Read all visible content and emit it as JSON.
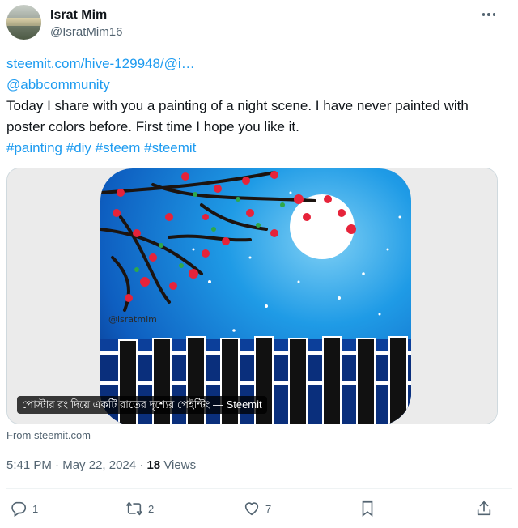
{
  "author": {
    "name": "Israt Mim",
    "handle": "@IsratMim16"
  },
  "post": {
    "link": "steemit.com/hive-129948/@i…",
    "mention": "@abbcommunity",
    "body": "Today I share with you a painting of a night scene. I have never painted with poster colors before. First time I hope you like it.",
    "hashtags": [
      "#painting",
      "#diy",
      "#steem",
      "#steemit"
    ]
  },
  "card": {
    "caption": "পোস্টার রং দিয়ে একটি রাতের দৃশ্যের পেইন্টিং — Steemit",
    "source": "From steemit.com",
    "watermark": "@isratmim"
  },
  "meta": {
    "time": "5:41 PM",
    "date": "May 22, 2024",
    "separator": "·",
    "views_count": "18",
    "views_label": "Views"
  },
  "actions": {
    "replies": "1",
    "reposts": "2",
    "likes": "7"
  },
  "colors": {
    "link": "#1d9bf0",
    "secondary_text": "#536471",
    "divider": "#eff3f4",
    "sky": "#1f9be6"
  },
  "icons": [
    "more-icon",
    "reply-icon",
    "repost-icon",
    "like-icon",
    "bookmark-icon",
    "share-icon"
  ]
}
